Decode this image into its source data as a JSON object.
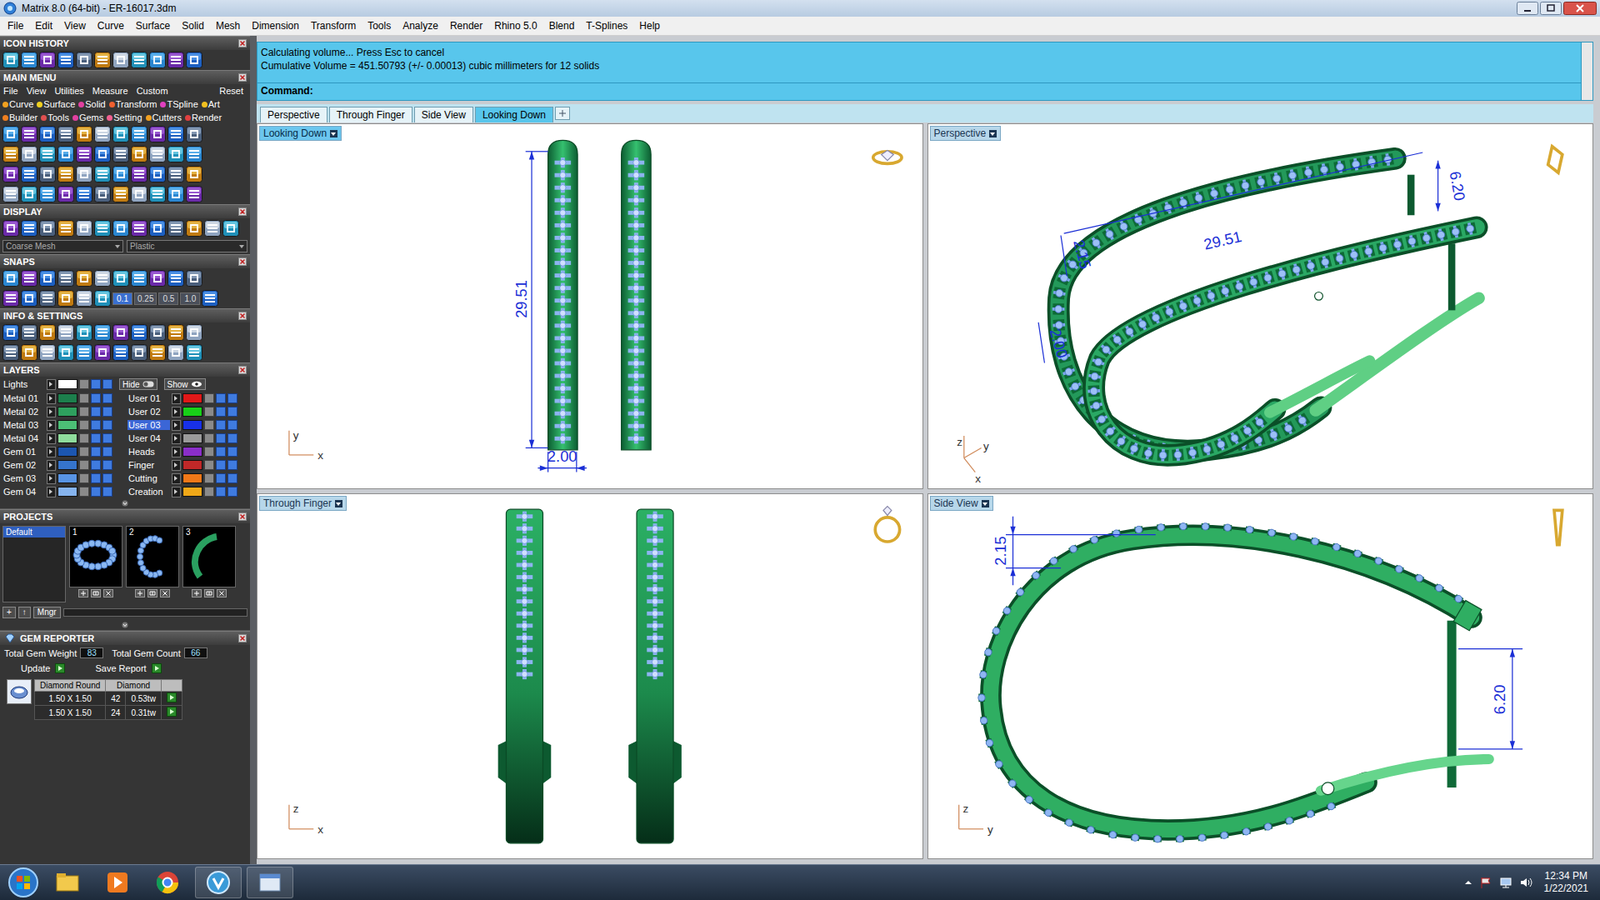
{
  "window": {
    "title": "Matrix 8.0 (64-bit) - ER-16017.3dm"
  },
  "menubar": [
    "File",
    "Edit",
    "View",
    "Curve",
    "Surface",
    "Solid",
    "Mesh",
    "Dimension",
    "Transform",
    "Tools",
    "Analyze",
    "Render",
    "Rhino 5.0",
    "Blend",
    "T-Splines",
    "Help"
  ],
  "command": {
    "lines": [
      "Calculating volume... Press Esc to cancel",
      "Cumulative Volume = 451.50793 (+/- 0.00013) cubic millimeters for 12 solids"
    ],
    "prompt": "Command:"
  },
  "view_tabs": [
    {
      "label": "Perspective",
      "selected": false
    },
    {
      "label": "Through Finger",
      "selected": false
    },
    {
      "label": "Side View",
      "selected": false
    },
    {
      "label": "Looking Down",
      "selected": true
    }
  ],
  "viewports": [
    {
      "label": "Looking Down",
      "kind": "top",
      "active": true,
      "axes": [
        "y",
        "x"
      ],
      "dims": [
        "29.51",
        "2.00"
      ]
    },
    {
      "label": "Perspective",
      "kind": "perspective",
      "active": false,
      "axes": [
        "z",
        "y",
        "x"
      ],
      "dims": [
        "29.51",
        "6.20",
        "2.15",
        "2.00"
      ]
    },
    {
      "label": "Through Finger",
      "kind": "front",
      "active": false,
      "axes": [
        "z",
        "x"
      ],
      "dims": []
    },
    {
      "label": "Side View",
      "kind": "side",
      "active": false,
      "axes": [
        "z",
        "y"
      ],
      "dims": [
        "2.15",
        "6.20"
      ]
    }
  ],
  "left_panel": {
    "icon_history": {
      "title": "ICON HISTORY"
    },
    "main_menu": {
      "title": "MAIN MENU",
      "menu": [
        "File",
        "View",
        "Utilities",
        "Measure",
        "Custom"
      ],
      "reset": "Reset",
      "categories": [
        [
          {
            "label": "Curve",
            "color": "#f0a020"
          },
          {
            "label": "Surface",
            "color": "#f0d020"
          },
          {
            "label": "Solid",
            "color": "#e040a0"
          },
          {
            "label": "Transform",
            "color": "#f06030"
          },
          {
            "label": "TSpline",
            "color": "#e040c0"
          },
          {
            "label": "Art",
            "color": "#f0c020"
          }
        ],
        [
          {
            "label": "Builder",
            "color": "#f08020"
          },
          {
            "label": "Tools",
            "color": "#e05050"
          },
          {
            "label": "Gems",
            "color": "#e040a0"
          },
          {
            "label": "Setting",
            "color": "#f06090"
          },
          {
            "label": "Cutters",
            "color": "#f0a020"
          },
          {
            "label": "Render",
            "color": "#e04040"
          }
        ]
      ]
    },
    "display": {
      "title": "DISPLAY",
      "mesh": "Coarse Mesh",
      "material": "Plastic"
    },
    "snaps": {
      "title": "SNAPS",
      "steps": [
        {
          "label": "0.1",
          "selected": true
        },
        {
          "label": "0.25",
          "selected": false
        },
        {
          "label": "0.5",
          "selected": false
        },
        {
          "label": "1.0",
          "selected": false
        }
      ]
    },
    "info": {
      "title": "INFO & SETTINGS"
    },
    "layers": {
      "title": "LAYERS",
      "lights": {
        "label": "Lights",
        "color": "#ffffff",
        "hide": "Hide",
        "show": "Show"
      },
      "left": [
        {
          "label": "Metal 01",
          "color": "#1c7f4c",
          "selected": false
        },
        {
          "label": "Metal 02",
          "color": "#2ea05e",
          "selected": false
        },
        {
          "label": "Metal 03",
          "color": "#4cbf76",
          "selected": false
        },
        {
          "label": "Metal 04",
          "color": "#8fdc9c",
          "selected": false
        },
        {
          "label": "Gem 01",
          "color": "#1c56b0",
          "selected": false
        },
        {
          "label": "Gem 02",
          "color": "#3574cc",
          "selected": false
        },
        {
          "label": "Gem 03",
          "color": "#5894e4",
          "selected": false
        },
        {
          "label": "Gem 04",
          "color": "#86b4ee",
          "selected": false
        }
      ],
      "right": [
        {
          "label": "User 01",
          "color": "#e01818",
          "selected": false
        },
        {
          "label": "User 02",
          "color": "#18d018",
          "selected": false
        },
        {
          "label": "User 03",
          "color": "#1830e8",
          "selected": true
        },
        {
          "label": "User 04",
          "color": "#9a9a9a",
          "selected": false
        },
        {
          "label": "Heads",
          "color": "#8a2ec8",
          "selected": false
        },
        {
          "label": "Finger",
          "color": "#c02828",
          "selected": false
        },
        {
          "label": "Cutting",
          "color": "#f07818",
          "selected": false
        },
        {
          "label": "Creation",
          "color": "#f0a818",
          "selected": false
        }
      ]
    },
    "projects": {
      "title": "PROJECTS",
      "list": [
        {
          "label": "Default",
          "selected": true
        }
      ],
      "thumbs": [
        {
          "label": "1",
          "kind": "oval"
        },
        {
          "label": "2",
          "kind": "hoop"
        },
        {
          "label": "3",
          "kind": "band"
        }
      ],
      "buttons": [
        "+",
        "↑",
        "Mngr"
      ]
    },
    "gem_reporter": {
      "title": "GEM REPORTER",
      "weight_label": "Total Gem Weight",
      "weight": "83",
      "count_label": "Total Gem Count",
      "count": "66",
      "update": "Update",
      "save": "Save Report",
      "columns": [
        "Diamond Round",
        "Diamond"
      ],
      "rows": [
        [
          "1.50 X 1.50",
          "42",
          "0.53tw"
        ],
        [
          "1.50 X 1.50",
          "24",
          "0.31tw"
        ]
      ]
    }
  },
  "taskbar": {
    "time": "12:34 PM",
    "date": "1/22/2021"
  }
}
